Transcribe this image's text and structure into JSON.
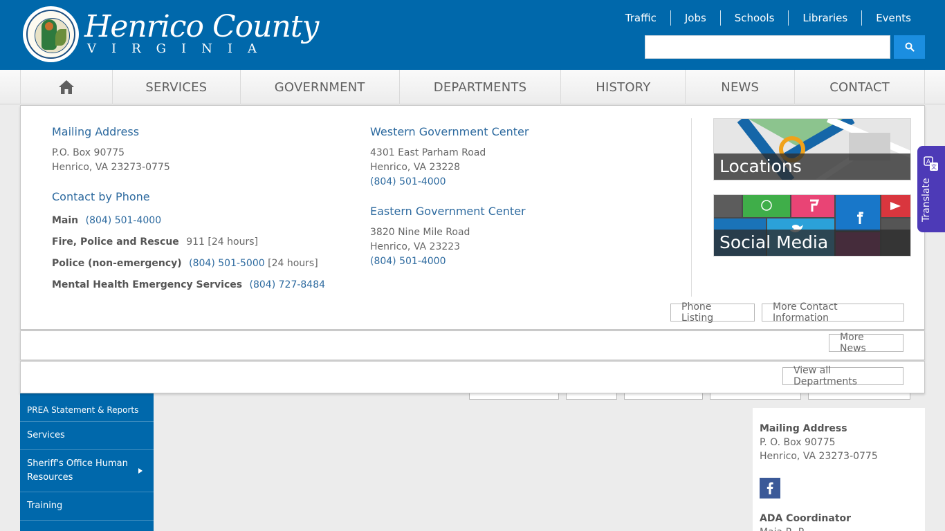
{
  "header": {
    "brand_title": "Henrico County",
    "brand_subtitle": "VIRGINIA",
    "quick_links": [
      "Traffic",
      "Jobs",
      "Schools",
      "Libraries",
      "Events"
    ],
    "search_placeholder": ""
  },
  "nav": {
    "items": [
      "SERVICES",
      "GOVERNMENT",
      "DEPARTMENTS",
      "HISTORY",
      "NEWS",
      "CONTACT"
    ]
  },
  "contact": {
    "mailing": {
      "title": "Mailing Address",
      "line1": "P.O. Box 90775",
      "line2": "Henrico, VA 23273-0775"
    },
    "phone": {
      "title": "Contact by Phone",
      "rows": [
        {
          "label": "Main",
          "number": "(804) 501-4000",
          "note": ""
        },
        {
          "label": "Fire, Police and Rescue",
          "number": "911",
          "note": "[24 hours]"
        },
        {
          "label": "Police (non-emergency)",
          "number": "(804) 501-5000",
          "note": "[24 hours]"
        },
        {
          "label": "Mental Health Emergency Services",
          "number": "(804) 727-8484",
          "note": ""
        }
      ]
    },
    "western": {
      "title": "Western Government Center",
      "line1": "4301 East Parham Road",
      "line2": "Henrico, VA 23228",
      "phone": "(804) 501-4000"
    },
    "eastern": {
      "title": "Eastern Government Center",
      "line1": "3820 Nine Mile Road",
      "line2": "Henrico, VA 23223",
      "phone": "(804) 501-4000"
    },
    "tiles": {
      "locations": "Locations",
      "social": "Social Media"
    },
    "buttons": {
      "phone_listing": "Phone Listing",
      "more_contact": "More Contact Information"
    }
  },
  "news_panel": {
    "more_news": "More News"
  },
  "departments_panel": {
    "view_all": "View all Departments"
  },
  "sidebar": {
    "items": [
      "PREA Statement & Reports",
      "Services",
      "Sheriff's Office Human Resources",
      "Training",
      ""
    ]
  },
  "right_column": {
    "mailing_title": "Mailing Address",
    "line1": "P. O. Box 90775",
    "line2": "Henrico, VA 23273-0775",
    "ada_title": "ADA Coordinator",
    "ada_name": "Maia R. P..."
  },
  "translate": {
    "label": "Translate"
  },
  "colors": {
    "brand_blue": "#0068ab",
    "link_blue": "#2d6a9f",
    "search_button": "#1b8ee0",
    "translate_purple": "#4d3ab7"
  }
}
